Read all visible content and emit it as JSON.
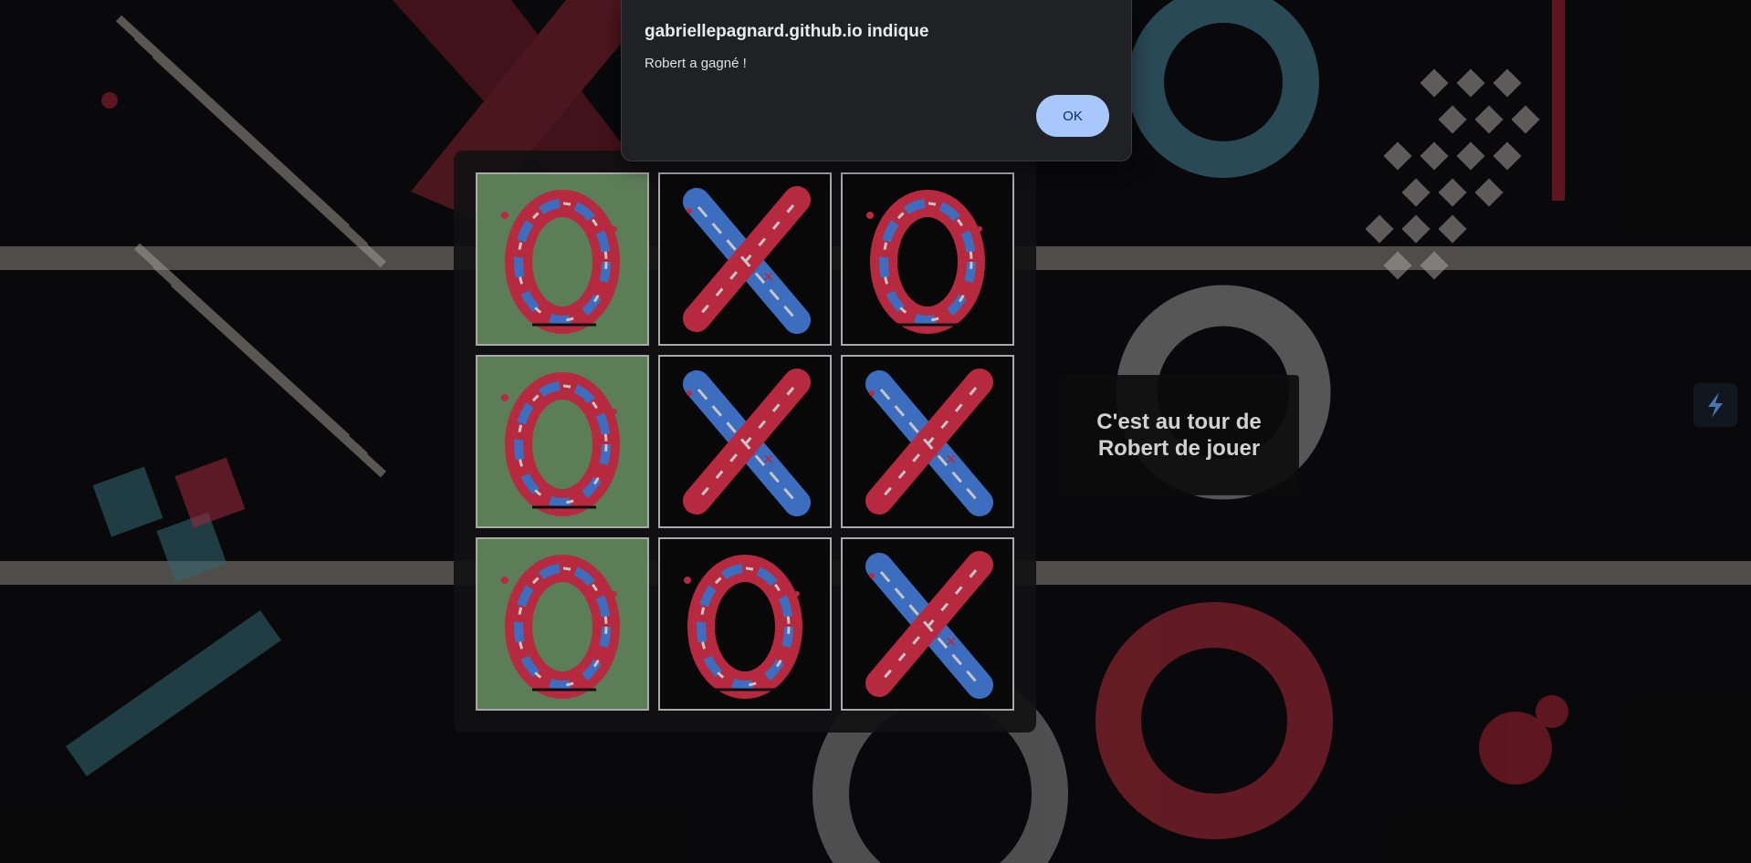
{
  "dialog": {
    "title": "gabriellepagnard.github.io indique",
    "message": "Robert a gagné !",
    "ok_label": "OK"
  },
  "status": {
    "text": "C'est au tour de Robert de jouer"
  },
  "board": {
    "cells": [
      "O",
      "X",
      "O",
      "O",
      "X",
      "X",
      "O",
      "O",
      "X"
    ],
    "winning_cells": [
      0,
      3,
      6
    ]
  },
  "colors": {
    "win_cell": "#6f9a6a",
    "cell_border": "#cfcfcf",
    "dialog_bg": "#202124",
    "ok_button": "#a8c7fa",
    "mark_red": "#e0324e",
    "mark_blue": "#4a86e8"
  },
  "icons": {
    "side": "lightning-icon"
  }
}
